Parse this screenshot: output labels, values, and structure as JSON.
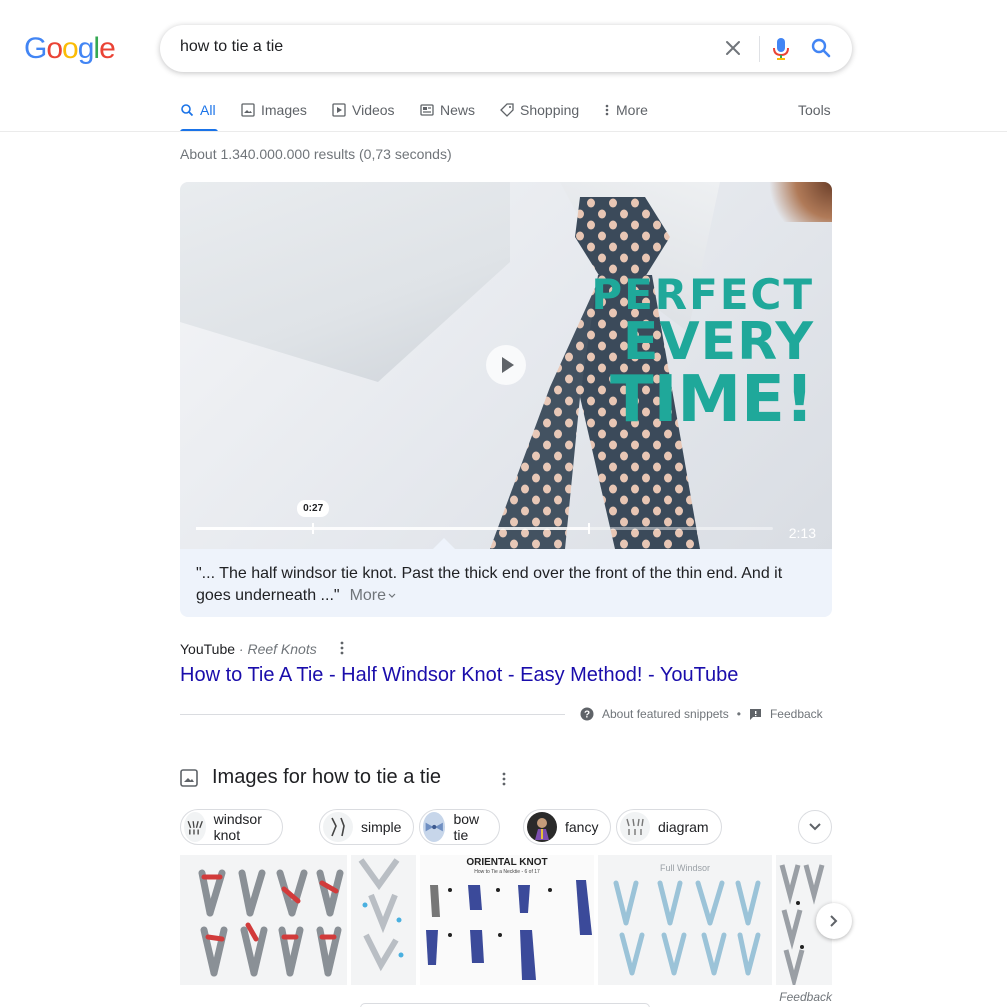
{
  "logo": {
    "letters": [
      "G",
      "o",
      "o",
      "g",
      "l",
      "e"
    ],
    "colors": [
      "#4285F4",
      "#EA4335",
      "#FBBC05",
      "#4285F4",
      "#34A853",
      "#EA4335"
    ]
  },
  "search": {
    "query": "how to tie a tie"
  },
  "tabs": [
    {
      "label": "All",
      "icon": "search-icon",
      "active": true
    },
    {
      "label": "Images",
      "icon": "image-icon"
    },
    {
      "label": "Videos",
      "icon": "play-icon"
    },
    {
      "label": "News",
      "icon": "news-icon"
    },
    {
      "label": "Shopping",
      "icon": "tag-icon"
    },
    {
      "label": "More",
      "icon": "more-vert-icon"
    }
  ],
  "tools_label": "Tools",
  "results_stats": "About 1.340.000.000 results (0,73 seconds)",
  "video": {
    "overlay_line1": "PERFECT",
    "overlay_line2": "EVERY",
    "overlay_line3": "TIME!",
    "current_time": "0:27",
    "duration": "2:13",
    "progress": 0.203,
    "buffered": 0.68
  },
  "snippet": {
    "text": "\"... The half windsor tie knot. Past the thick end over the front of the thin end. And it goes underneath ...\"",
    "more_label": "More"
  },
  "result": {
    "source": "YouTube",
    "source_sub": "Reef Knots",
    "source_separator": " · ",
    "title": "How to Tie A Tie - Half Windsor Knot - Easy Method! - YouTube"
  },
  "snippet_footer": {
    "about_label": "About featured snippets",
    "separator": "•",
    "feedback_label": "Feedback"
  },
  "images_section": {
    "title": "Images for how to tie a tie",
    "chips": [
      "windsor knot",
      "simple",
      "bow tie",
      "fancy",
      "diagram"
    ],
    "tiles": [
      {
        "title": ""
      },
      {
        "title": ""
      },
      {
        "title": "ORIENTAL KNOT",
        "subtitle": "How to Tie a Necktie - 6 of 17"
      },
      {
        "title": "Full Windsor"
      },
      {
        "title": ""
      }
    ],
    "feedback_label": "Feedback"
  },
  "colors": {
    "accent": "#1a73e8",
    "link": "#1a0dab",
    "video_text": "#1fa89a",
    "snippet_bg": "#eef3fb"
  }
}
